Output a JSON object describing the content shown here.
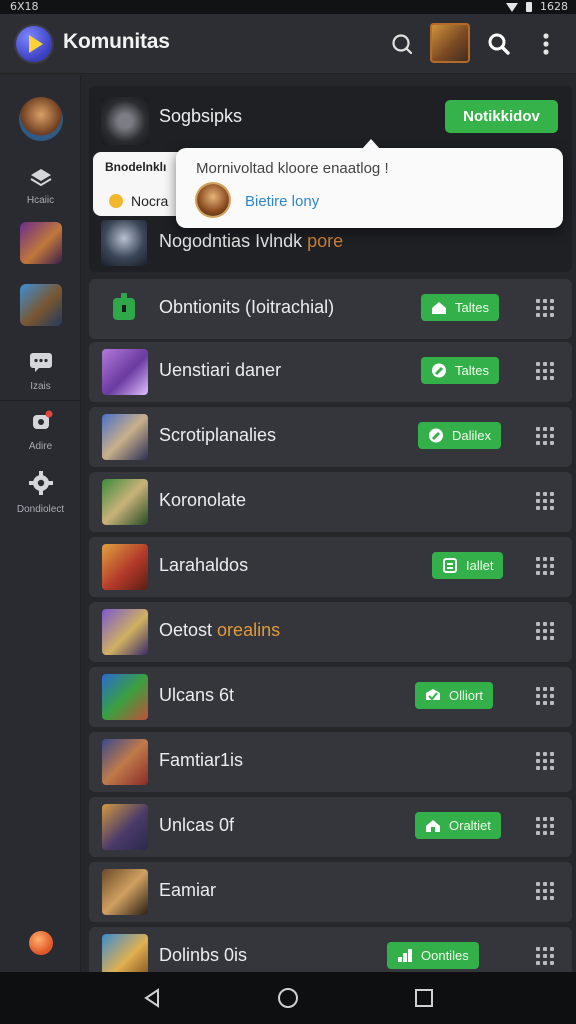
{
  "status": {
    "time": "6X18",
    "right_text": "1628"
  },
  "app": {
    "title": "Komunitas"
  },
  "sidebar": {
    "labels": [
      "Hcaiic",
      "Izais",
      "Adire",
      "Dondiolect"
    ]
  },
  "featured": {
    "title": "Sogbsipks",
    "notify_label": "Notikkidov",
    "line3_text": "Nogodntias Ivlndk",
    "line3_more": "pore",
    "card": {
      "line1": "Bnodelnklı",
      "line2": "Nocra"
    },
    "popup": {
      "heading": "Mornivoltad kloore enaatlog !",
      "link": "Bietire lony"
    }
  },
  "rows": [
    {
      "title": "Obntionits (Ioitrachial)",
      "pill": "Taltes"
    },
    {
      "title": "Uenstiari daner",
      "pill": "Taltes"
    },
    {
      "title": "Scrotiplanalies",
      "pill": "Dalilex"
    },
    {
      "title": "Koronolate",
      "pill": ""
    },
    {
      "title": "Larahaldos",
      "pill": "Iallet"
    },
    {
      "title_a": "Oetost",
      "title_b": "orealins",
      "pill": ""
    },
    {
      "title": "Ulcans 6t",
      "pill": "Olliort"
    },
    {
      "title": "Famtiar1is",
      "pill": ""
    },
    {
      "title": "Unlcas 0f",
      "pill": "Oraltiet"
    },
    {
      "title": "Eamiar",
      "pill": ""
    },
    {
      "title": "Dolinbs 0is",
      "pill": "Oontiles"
    }
  ],
  "colors": {
    "accent_green": "#35b34a",
    "background": "#26272b",
    "row": "#35363c"
  }
}
